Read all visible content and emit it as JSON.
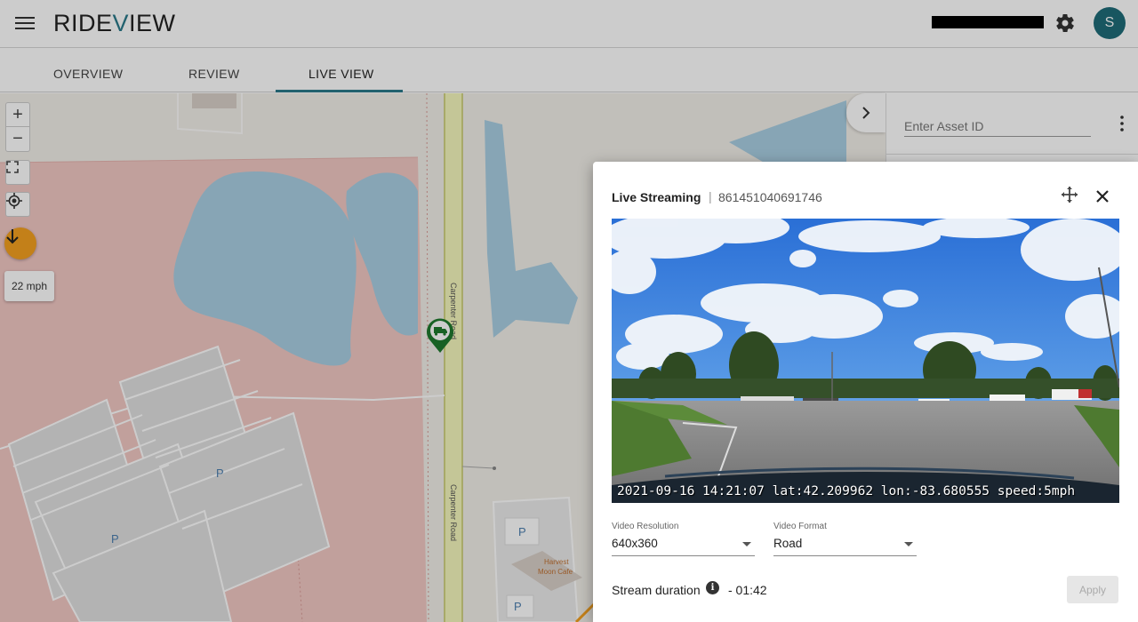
{
  "header": {
    "logo_prefix": "RIDE",
    "logo_v": "V",
    "logo_suffix": "IEW",
    "avatar_initial": "S"
  },
  "tabs": [
    {
      "label": "OVERVIEW"
    },
    {
      "label": "REVIEW"
    },
    {
      "label": "LIVE VIEW",
      "active": true
    }
  ],
  "map": {
    "zoom_in": "+",
    "zoom_out": "−",
    "speed": "22 mph",
    "road_label": "Carpenter Road",
    "parking_label": "P",
    "poi_label_1": "Harvest",
    "poi_label_2": "Moon Cafe"
  },
  "side_panel": {
    "asset_placeholder": "Enter Asset ID"
  },
  "dialog": {
    "title": "Live Streaming",
    "separator": "|",
    "device_id": "861451040691746",
    "video_overlay": "2021-09-16 14:21:07 lat:42.209962 lon:-83.680555 speed:5mph",
    "resolution_label": "Video Resolution",
    "resolution_value": "640x360",
    "format_label": "Video Format",
    "format_value": "Road",
    "duration_label": "Stream duration",
    "duration_value": "- 01:42",
    "apply_label": "Apply"
  },
  "colors": {
    "brand": "#2b7a8a",
    "heading_button": "#f4a020",
    "map_pink": "#f2c8c4",
    "map_water": "#a9cfe3",
    "marker": "#1e7a2e"
  },
  "icons": [
    "menu-icon",
    "gear-icon",
    "fullscreen-icon",
    "locate-icon",
    "arrow-down-icon",
    "chevron-right-icon",
    "more-vert-icon",
    "move-icon",
    "close-icon",
    "info-icon",
    "truck-marker-icon"
  ]
}
